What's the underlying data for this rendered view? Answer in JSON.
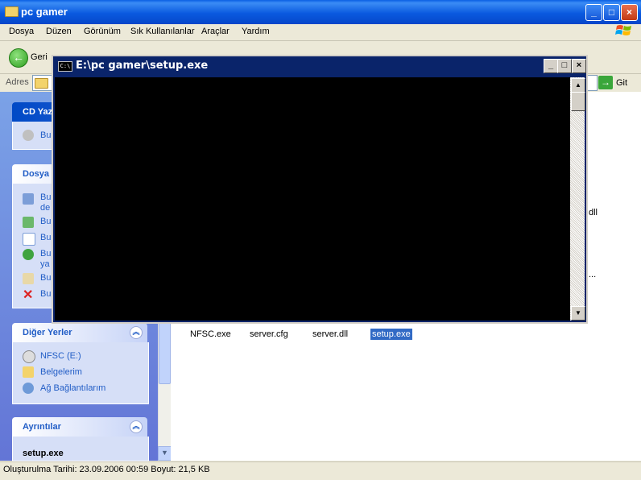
{
  "window": {
    "title": "pc gamer",
    "icons": {
      "folder": "folder-icon",
      "minimize": "minimize-icon",
      "maximize": "maximize-icon",
      "close": "close-icon"
    }
  },
  "menu": [
    "Dosya",
    "Düzen",
    "Görünüm",
    "Sık Kullanılanlar",
    "Araçlar",
    "Yardım"
  ],
  "toolbar": {
    "back_label": "Geri"
  },
  "address": {
    "label": "Adres",
    "go_label": "Git"
  },
  "taskpane": {
    "cd_panel": {
      "title": "CD Yaz",
      "items": [
        "Bu"
      ]
    },
    "file_panel": {
      "title": "Dosya",
      "items": [
        "Bu\nde",
        "Bu",
        "Bu",
        "Bu\nya",
        "Bu",
        "Bu"
      ]
    },
    "other_places": {
      "title": "Diğer Yerler",
      "items": [
        "NFSC (E:)",
        "Belgelerim",
        "Ağ Bağlantılarım"
      ]
    },
    "details": {
      "title": "Ayrıntılar",
      "filename": "setup.exe"
    }
  },
  "files": [
    "NFSC.exe",
    "server.cfg",
    "server.dll",
    "setup.exe"
  ],
  "partial_labels": {
    "dll": "dll",
    "ellipsis": "..."
  },
  "status": {
    "text": "Oluşturulma Tarihi: 23.09.2006 00:59 Boyut: 21,5 KB"
  },
  "console": {
    "title": "E:\\pc gamer\\setup.exe",
    "icon_text": "C:\\",
    "buttons": {
      "minimize": "_",
      "maximize": "□",
      "close": "×"
    }
  },
  "colors": {
    "xp_blue": "#0A5FE3",
    "console_title": "#0A246A",
    "selection": "#316AC5"
  }
}
